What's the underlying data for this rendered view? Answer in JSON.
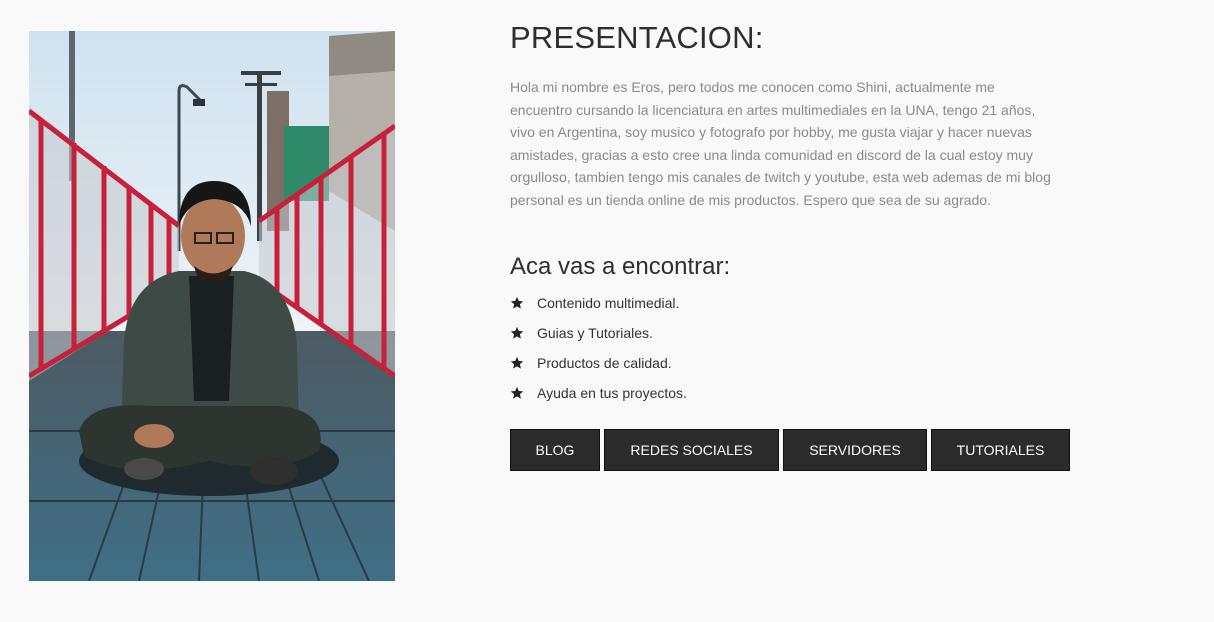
{
  "photo": {
    "alt": "Eros sentado en un puente de madera con barandas rojas"
  },
  "presentation": {
    "title": "PRESENTACION:",
    "text": "Hola mi nombre es Eros, pero todos me conocen como Shini, actualmente me encuentro cursando la licenciatura en artes multimediales en la UNA, tengo 21 años, vivo en Argentina, soy musico y fotografo por hobby, me gusta viajar y hacer nuevas amistades, gracias a esto cree una linda comunidad en discord de la cual estoy muy orgulloso, tambien tengo mis canales de twitch y youtube, esta web ademas de mi blog personal es un tienda online de mis productos. Espero que sea de su agrado."
  },
  "features": {
    "title": "Aca vas a encontrar:",
    "icon": "star-icon",
    "items": [
      "Contenido multimedial.",
      "Guias y Tutoriales.",
      "Productos de calidad.",
      "Ayuda en tus proyectos."
    ]
  },
  "buttons": {
    "blog": "BLOG",
    "redes": "REDES SOCIALES",
    "servidores": "SERVIDORES",
    "tutoriales": "TUTORIALES"
  },
  "colors": {
    "background": "#f9f9f9",
    "button": "#2b2b2b",
    "body_text": "#8a8a8a",
    "heading": "#2e2e2e"
  }
}
